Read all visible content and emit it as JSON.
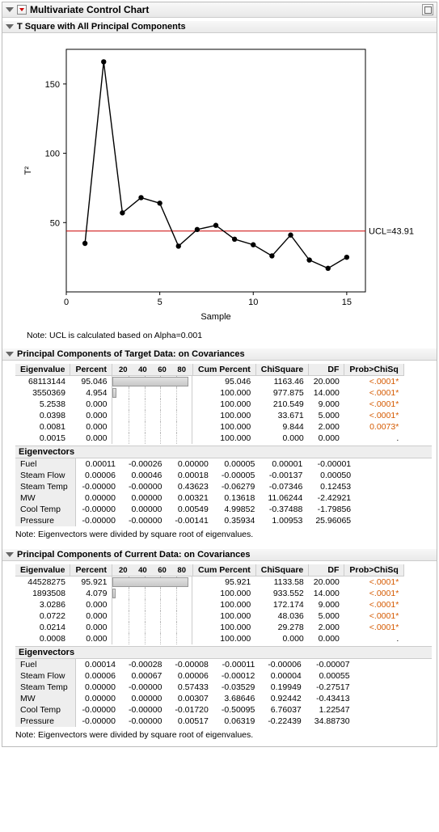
{
  "main_title": "Multivariate Control Chart",
  "chart_section_title": "T Square with All Principal Components",
  "chart_note": "Note: UCL is calculated based on Alpha=0.001",
  "chart_data": {
    "type": "line",
    "xlabel": "Sample",
    "ylabel": "T²",
    "xlim": [
      0,
      16
    ],
    "ylim": [
      0,
      175
    ],
    "xticks": [
      0,
      5,
      10,
      15
    ],
    "yticks": [
      50,
      100,
      150
    ],
    "ucl_value": 43.91,
    "ucl_label": "UCL=43.91",
    "series": [
      {
        "name": "T²",
        "x": [
          1,
          2,
          3,
          4,
          5,
          6,
          7,
          8,
          9,
          10,
          11,
          12,
          13,
          14,
          15
        ],
        "y": [
          35,
          166,
          57,
          68,
          64,
          33,
          45,
          48,
          38,
          34,
          26,
          41,
          23,
          17,
          25
        ]
      }
    ]
  },
  "pc_target": {
    "title": "Principal Components of Target Data: on Covariances",
    "headers": {
      "eigen": "Eigenvalue",
      "percent": "Percent",
      "barticks": [
        "20",
        "40",
        "60",
        "80"
      ],
      "cum": "Cum Percent",
      "chi": "ChiSquare",
      "df": "DF",
      "prob": "Prob>ChiSq"
    },
    "rows": [
      {
        "eigen": "68113144",
        "percent": "95.046",
        "bar": 95.046,
        "cum": "95.046",
        "chi": "1163.46",
        "df": "20.000",
        "prob": "<.0001*",
        "sig": true
      },
      {
        "eigen": "3550369",
        "percent": "4.954",
        "bar": 4.954,
        "cum": "100.000",
        "chi": "977.875",
        "df": "14.000",
        "prob": "<.0001*",
        "sig": true
      },
      {
        "eigen": "5.2538",
        "percent": "0.000",
        "bar": 0,
        "cum": "100.000",
        "chi": "210.549",
        "df": "9.000",
        "prob": "<.0001*",
        "sig": true
      },
      {
        "eigen": "0.0398",
        "percent": "0.000",
        "bar": 0,
        "cum": "100.000",
        "chi": "33.671",
        "df": "5.000",
        "prob": "<.0001*",
        "sig": true
      },
      {
        "eigen": "0.0081",
        "percent": "0.000",
        "bar": 0,
        "cum": "100.000",
        "chi": "9.844",
        "df": "2.000",
        "prob": "0.0073*",
        "sig": true
      },
      {
        "eigen": "0.0015",
        "percent": "0.000",
        "bar": 0,
        "cum": "100.000",
        "chi": "0.000",
        "df": "0.000",
        "prob": ".",
        "sig": false
      }
    ],
    "eigenvectors_label": "Eigenvectors",
    "eigenvectors": [
      {
        "name": "Fuel",
        "v": [
          "0.00011",
          "-0.00026",
          "0.00000",
          "0.00005",
          "0.00001",
          "-0.00001"
        ]
      },
      {
        "name": "Steam Flow",
        "v": [
          "0.00006",
          "0.00046",
          "0.00018",
          "-0.00005",
          "-0.00137",
          "0.00050"
        ]
      },
      {
        "name": "Steam Temp",
        "v": [
          "-0.00000",
          "-0.00000",
          "0.43623",
          "-0.06279",
          "-0.07346",
          "0.12453"
        ]
      },
      {
        "name": "MW",
        "v": [
          "0.00000",
          "0.00000",
          "0.00321",
          "0.13618",
          "11.06244",
          "-2.42921"
        ]
      },
      {
        "name": "Cool Temp",
        "v": [
          "-0.00000",
          "0.00000",
          "0.00549",
          "4.99852",
          "-0.37488",
          "-1.79856"
        ]
      },
      {
        "name": "Pressure",
        "v": [
          "-0.00000",
          "-0.00000",
          "-0.00141",
          "0.35934",
          "1.00953",
          "25.96065"
        ]
      }
    ],
    "note": "Note: Eigenvectors were divided by square root of eigenvalues."
  },
  "pc_current": {
    "title": "Principal Components of Current Data: on Covariances",
    "headers": {
      "eigen": "Eigenvalue",
      "percent": "Percent",
      "barticks": [
        "20",
        "40",
        "60",
        "80"
      ],
      "cum": "Cum Percent",
      "chi": "ChiSquare",
      "df": "DF",
      "prob": "Prob>ChiSq"
    },
    "rows": [
      {
        "eigen": "44528275",
        "percent": "95.921",
        "bar": 95.921,
        "cum": "95.921",
        "chi": "1133.58",
        "df": "20.000",
        "prob": "<.0001*",
        "sig": true
      },
      {
        "eigen": "1893508",
        "percent": "4.079",
        "bar": 4.079,
        "cum": "100.000",
        "chi": "933.552",
        "df": "14.000",
        "prob": "<.0001*",
        "sig": true
      },
      {
        "eigen": "3.0286",
        "percent": "0.000",
        "bar": 0,
        "cum": "100.000",
        "chi": "172.174",
        "df": "9.000",
        "prob": "<.0001*",
        "sig": true
      },
      {
        "eigen": "0.0722",
        "percent": "0.000",
        "bar": 0,
        "cum": "100.000",
        "chi": "48.036",
        "df": "5.000",
        "prob": "<.0001*",
        "sig": true
      },
      {
        "eigen": "0.0214",
        "percent": "0.000",
        "bar": 0,
        "cum": "100.000",
        "chi": "29.278",
        "df": "2.000",
        "prob": "<.0001*",
        "sig": true
      },
      {
        "eigen": "0.0008",
        "percent": "0.000",
        "bar": 0,
        "cum": "100.000",
        "chi": "0.000",
        "df": "0.000",
        "prob": ".",
        "sig": false
      }
    ],
    "eigenvectors_label": "Eigenvectors",
    "eigenvectors": [
      {
        "name": "Fuel",
        "v": [
          "0.00014",
          "-0.00028",
          "-0.00008",
          "-0.00011",
          "-0.00006",
          "-0.00007"
        ]
      },
      {
        "name": "Steam Flow",
        "v": [
          "0.00006",
          "0.00067",
          "0.00006",
          "-0.00012",
          "0.00004",
          "0.00055"
        ]
      },
      {
        "name": "Steam Temp",
        "v": [
          "0.00000",
          "-0.00000",
          "0.57433",
          "-0.03529",
          "0.19949",
          "-0.27517"
        ]
      },
      {
        "name": "MW",
        "v": [
          "0.00000",
          "0.00000",
          "0.00307",
          "3.68646",
          "0.92442",
          "-0.43413"
        ]
      },
      {
        "name": "Cool Temp",
        "v": [
          "-0.00000",
          "-0.00000",
          "-0.01720",
          "-0.50095",
          "6.76037",
          "1.22547"
        ]
      },
      {
        "name": "Pressure",
        "v": [
          "-0.00000",
          "-0.00000",
          "0.00517",
          "0.06319",
          "-0.22439",
          "34.88730"
        ]
      }
    ],
    "note": "Note: Eigenvectors were divided by square root of eigenvalues."
  }
}
